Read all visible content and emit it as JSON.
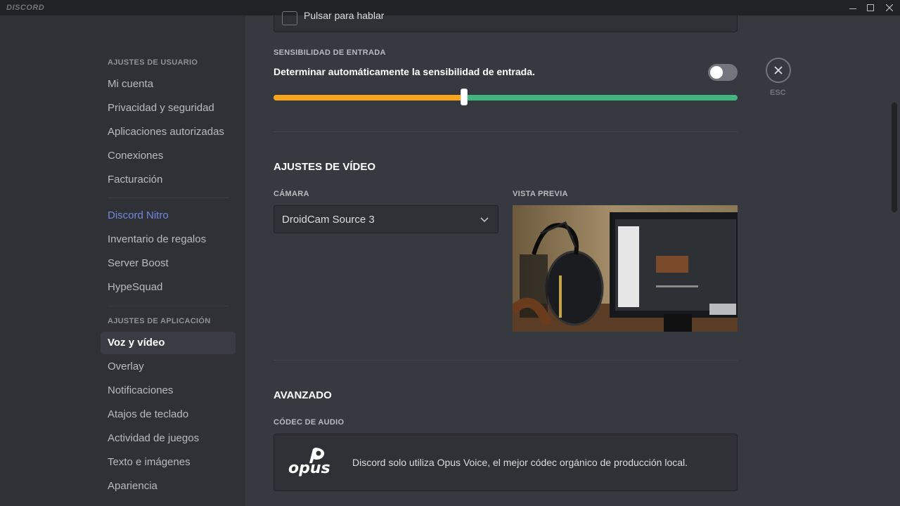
{
  "titlebar": {
    "brand": "DISCORD"
  },
  "sidebar": {
    "user_header": "AJUSTES DE USUARIO",
    "user_items": [
      "Mi cuenta",
      "Privacidad y seguridad",
      "Aplicaciones autorizadas",
      "Conexiones",
      "Facturación"
    ],
    "nitro_items": [
      "Discord Nitro",
      "Inventario de regalos",
      "Server Boost",
      "HypeSquad"
    ],
    "app_header": "AJUSTES DE APLICACIÓN",
    "app_items": [
      "Voz y vídeo",
      "Overlay",
      "Notificaciones",
      "Atajos de teclado",
      "Actividad de juegos",
      "Texto e imágenes",
      "Apariencia"
    ],
    "active_item": "Voz y vídeo"
  },
  "voice": {
    "push_to_talk_label": "Pulsar para hablar",
    "sensitivity_label": "SENSIBILIDAD DE ENTRADA",
    "auto_sensitivity_text": "Determinar automáticamente la sensibilidad de entrada.",
    "auto_sensitivity_enabled": false,
    "sensitivity_level": 0.41
  },
  "video": {
    "title": "AJUSTES DE VÍDEO",
    "camera_label": "CÁMARA",
    "camera_value": "DroidCam Source 3",
    "preview_label": "VISTA PREVIA"
  },
  "advanced": {
    "title": "AVANZADO",
    "codec_label": "CÓDEC DE AUDIO",
    "codec_logo_text": "opus",
    "codec_text": "Discord solo utiliza Opus Voice, el mejor códec orgánico de producción local."
  },
  "close": {
    "label": "ESC"
  },
  "colors": {
    "accent": "#7289da",
    "slider_low": "#faa61a",
    "slider_high": "#43b581",
    "background": "#36393f",
    "sidebar": "#2f3136"
  }
}
